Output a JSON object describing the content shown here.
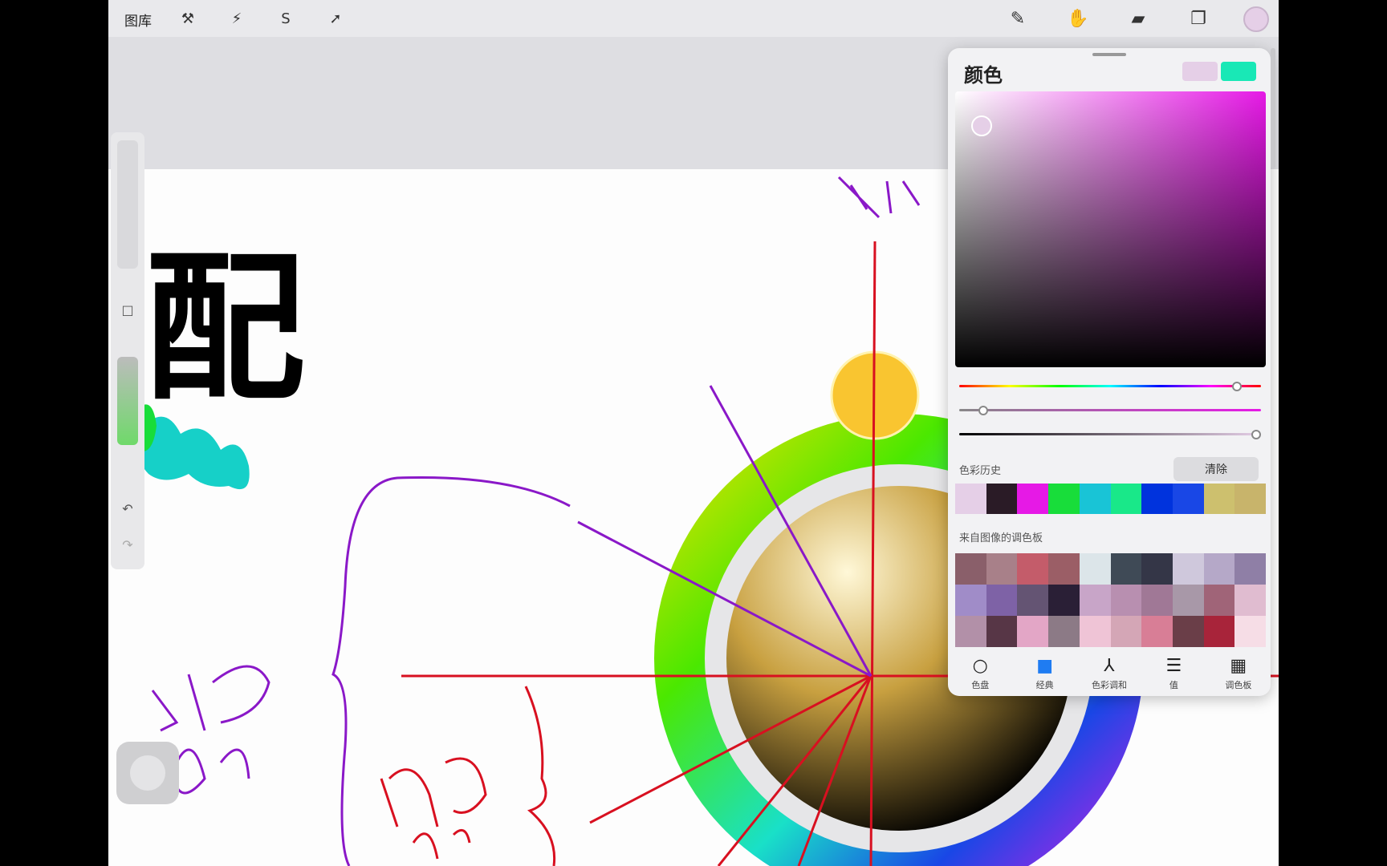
{
  "topbar": {
    "gallery_label": "图库",
    "left_tools": [
      {
        "name": "wrench-icon",
        "glyph": "⚒"
      },
      {
        "name": "magic-wand-icon",
        "glyph": "⚡"
      },
      {
        "name": "selection-s-icon",
        "glyph": "S"
      },
      {
        "name": "transform-arrow-icon",
        "glyph": "➚"
      }
    ],
    "right_tools": [
      {
        "name": "brush-icon",
        "glyph": "✎"
      },
      {
        "name": "smudge-icon",
        "glyph": "✋"
      },
      {
        "name": "eraser-icon",
        "glyph": "▰"
      },
      {
        "name": "layers-icon",
        "glyph": "❐"
      }
    ],
    "current_color": "#e5cfe7"
  },
  "canvas": {
    "title_text": "配"
  },
  "color_panel": {
    "title": "颜色",
    "primary_swatch": "#e5cfe7",
    "secondary_swatch": "#19e8b6",
    "hue_position": 0.92,
    "saturation_position": 0.1,
    "value_position": 0.95,
    "history_label": "色彩历史",
    "clear_label": "清除",
    "history_colors": [
      "#e5cfe7",
      "#2a1b26",
      "#e619e6",
      "#18dd3a",
      "#19c4d6",
      "#19e889",
      "#0033dd",
      "#1947e6",
      "#cdc06e",
      "#c8b46b"
    ],
    "palette_label": "来自图像的调色板",
    "palette_colors": [
      "#8a5f6a",
      "#a88089",
      "#c45c6a",
      "#9b5e66",
      "#dce5e9",
      "#3f4a56",
      "#343647",
      "#cfc8dc",
      "#b5a8c8",
      "#8f7fa6",
      "#a08cc8",
      "#7e62a6",
      "#645473",
      "#2a1f36",
      "#c8a5c8",
      "#b88fb0",
      "#a07896",
      "#a898a8",
      "#a06478",
      "#e0bcd0",
      "#b290a8",
      "#573646",
      "#e3a6c6",
      "#8c7a86",
      "#efc4d6",
      "#d4a6b6",
      "#d87e96",
      "#6a3e48",
      "#a8243a",
      "#f6dde6"
    ],
    "tabs": [
      {
        "glyph": "○",
        "label": "色盘",
        "icon_name": "disc-icon"
      },
      {
        "glyph": "■",
        "label": "经典",
        "icon_name": "classic-square-icon"
      },
      {
        "glyph": "⅄",
        "label": "色彩调和",
        "icon_name": "harmony-icon"
      },
      {
        "glyph": "☰",
        "label": "值",
        "icon_name": "value-bars-icon"
      },
      {
        "glyph": "▦",
        "label": "调色板",
        "icon_name": "palette-grid-icon"
      }
    ]
  }
}
